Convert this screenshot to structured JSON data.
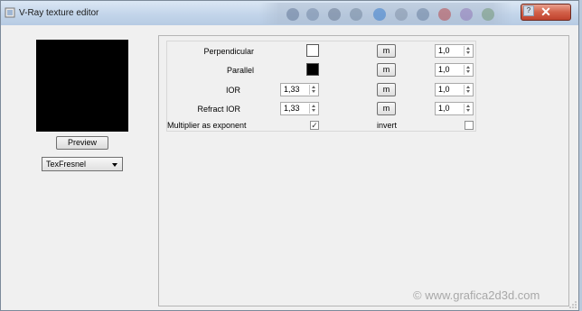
{
  "window": {
    "title": "V-Ray texture editor",
    "close_glyph": "✕",
    "help_glyph": "?"
  },
  "left_panel": {
    "preview_button": "Preview",
    "texture_type": "TexFresnel"
  },
  "params": {
    "perpendicular": {
      "label": "Perpendicular",
      "color": "#ffffff",
      "map_button": "m",
      "amount": "1,0"
    },
    "parallel": {
      "label": "Parallel",
      "color": "#000000",
      "map_button": "m",
      "amount": "1,0"
    },
    "ior": {
      "label": "IOR",
      "value": "1,33",
      "map_button": "m",
      "amount": "1,0"
    },
    "refract_ior": {
      "label": "Refract IOR",
      "value": "1,33",
      "map_button": "m",
      "amount": "1,0"
    },
    "multiplier_as_exponent": {
      "label": "Multiplier as exponent",
      "checked": true
    },
    "invert": {
      "label": "invert",
      "checked": false
    }
  },
  "watermark": "© www.grafica2d3d.com"
}
